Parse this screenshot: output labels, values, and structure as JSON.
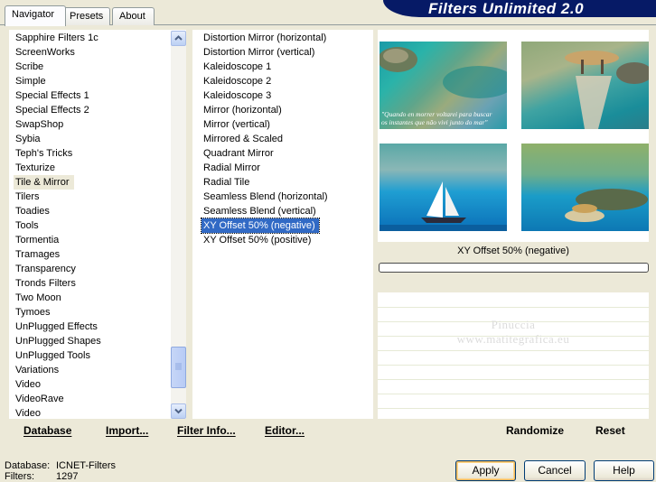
{
  "tabs": [
    {
      "label": "Navigator"
    },
    {
      "label": "Presets"
    },
    {
      "label": "About"
    }
  ],
  "app_title": "Filters Unlimited 2.0",
  "categories": {
    "items": [
      "Sapphire Filters 1c",
      "ScreenWorks",
      "Scribe",
      "Simple",
      "Special Effects 1",
      "Special Effects 2",
      "SwapShop",
      "Sybia",
      "Teph's Tricks",
      "Texturize",
      "Tile & Mirror",
      "Tilers",
      "Toadies",
      "Tools",
      "Tormentia",
      "Tramages",
      "Transparency",
      "Tronds Filters",
      "Two Moon",
      "Tymoes",
      "UnPlugged Effects",
      "UnPlugged Shapes",
      "UnPlugged Tools",
      "Variations",
      "Video",
      "VideoRave",
      "Video"
    ],
    "selected": "Tile & Mirror"
  },
  "filters": {
    "items": [
      "Distortion Mirror (horizontal)",
      "Distortion Mirror (vertical)",
      "Kaleidoscope 1",
      "Kaleidoscope 2",
      "Kaleidoscope 3",
      "Mirror (horizontal)",
      "Mirror (vertical)",
      "Mirrored & Scaled",
      "Quadrant Mirror",
      "Radial Mirror",
      "Radial Tile",
      "Seamless Blend (horizontal)",
      "Seamless Blend (vertical)",
      "XY Offset 50% (negative)",
      "XY Offset 50% (positive)"
    ],
    "selected": "XY Offset 50% (negative)"
  },
  "preview": {
    "thumb1_caption_line1": "\"Quando en morrer voltarei para buscar",
    "thumb1_caption_line2": "os instantes que não vivi junto do mar\"",
    "filter_name": "XY Offset 50% (negative)",
    "progress": 0
  },
  "watermark": {
    "line1": "Pinuccia",
    "line2": "www.matitegrafica.eu"
  },
  "bottom_left": {
    "database": "Database",
    "import": "Import...",
    "filter_info": "Filter Info...",
    "editor": "Editor..."
  },
  "bottom_right": {
    "randomize": "Randomize",
    "reset": "Reset"
  },
  "status": {
    "database_label": "Database:",
    "database_value": "ICNET-Filters",
    "filters_label": "Filters:",
    "filters_value": "1297"
  },
  "buttons": {
    "apply": "Apply",
    "cancel": "Cancel",
    "help": "Help"
  },
  "colors": {
    "selection": "#316ac5",
    "banner": "#061a66"
  }
}
